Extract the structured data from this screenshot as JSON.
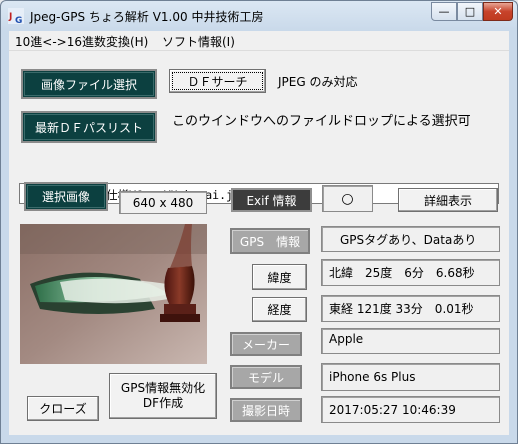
{
  "window": {
    "title": "Jpeg-GPS ちょろ解析 V1.00 中井技術工房",
    "controls": {
      "minimize": "—",
      "maximize": "□",
      "close": "✕"
    }
  },
  "menu": {
    "items": [
      "10進<->16進数変換(H)",
      "ソフト情報(I)"
    ]
  },
  "buttons": {
    "select_image_file": "画像ファイル選択",
    "df_search": "ＤＦサーチ",
    "recent_df_path_list": "最新ＤＦパスリスト",
    "selected_image": "選択画像",
    "exif_info": "Exif 情報",
    "detail_view": "詳細表示",
    "gps_info": "GPS　情報",
    "latitude": "緯度",
    "longitude": "経度",
    "maker": "メーカー",
    "model": "モデル",
    "shot_datetime": "撮影日時",
    "close": "クローズ",
    "gps_disable_line1": "GPS情報無効化",
    "gps_disable_line2": "DF作成"
  },
  "labels": {
    "jpeg_only": "JPEG のみ対応",
    "drop_hint": "このウインドウへのファイルドロップによる選択可"
  },
  "file_path": "E:¥Jpeg¥Exif仕様¥Gazo¥Hakusai.jpg",
  "image_size": "640 x 480",
  "exif_present": "○",
  "gps_status": "GPSタグあり、Dataあり",
  "latitude_value": "北緯　25度　6分　6.68秒",
  "longitude_value": "東経 121度 33分　0.01秒",
  "maker_value": "Apple",
  "model_value": "iPhone 6s Plus",
  "datetime_value": "2017:05:27 10:46:39"
}
